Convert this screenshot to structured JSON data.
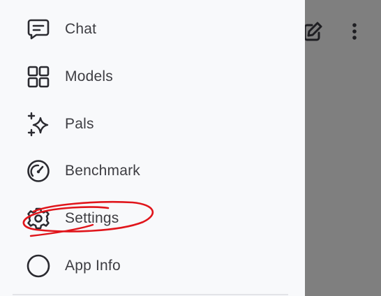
{
  "drawer": {
    "items": [
      {
        "label": "Chat",
        "icon": "chat-icon"
      },
      {
        "label": "Models",
        "icon": "grid-icon"
      },
      {
        "label": "Pals",
        "icon": "sparkles-icon"
      },
      {
        "label": "Benchmark",
        "icon": "speedometer-icon"
      },
      {
        "label": "Settings",
        "icon": "gear-icon"
      },
      {
        "label": "App Info",
        "icon": "info-circle-icon"
      }
    ]
  },
  "scrim": {
    "icons": [
      "edit-icon",
      "more-vertical-icon"
    ]
  },
  "colors": {
    "drawer_bg": "#f8f9fb",
    "scrim": "#7f7f7f",
    "text": "#3d3d42",
    "icon": "#2a2a30",
    "annotation": "#e0151b"
  }
}
